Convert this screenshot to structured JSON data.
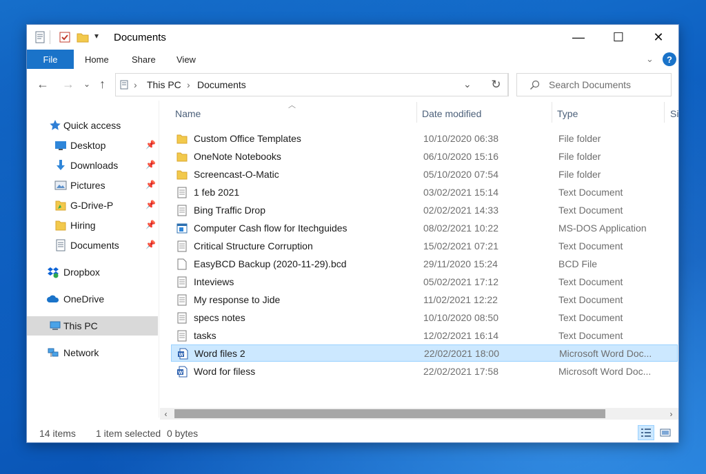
{
  "window": {
    "title": "Documents",
    "controls": {
      "minimize": "—",
      "maximize": "☐",
      "close": "✕"
    }
  },
  "ribbon": {
    "file": "File",
    "tabs": [
      "Home",
      "Share",
      "View"
    ],
    "help": "?"
  },
  "address": {
    "crumbs": [
      "This PC",
      "Documents"
    ],
    "search_placeholder": "Search Documents"
  },
  "navigation": {
    "items": [
      {
        "label": "Quick access",
        "icon": "star-icon",
        "pinned": false
      },
      {
        "label": "Desktop",
        "icon": "desktop-icon",
        "pinned": true
      },
      {
        "label": "Downloads",
        "icon": "download-arrow-icon",
        "pinned": true
      },
      {
        "label": "Pictures",
        "icon": "pictures-icon",
        "pinned": true
      },
      {
        "label": "G-Drive-P",
        "icon": "folder-icon",
        "pinned": true
      },
      {
        "label": "Hiring",
        "icon": "folder-icon",
        "pinned": true
      },
      {
        "label": "Documents",
        "icon": "documents-icon",
        "pinned": true
      },
      {
        "label": "Dropbox",
        "icon": "dropbox-icon",
        "pinned": false
      },
      {
        "label": "OneDrive",
        "icon": "cloud-icon",
        "pinned": false
      },
      {
        "label": "This PC",
        "icon": "computer-icon",
        "pinned": false,
        "selected": true
      },
      {
        "label": "Network",
        "icon": "network-icon",
        "pinned": false
      }
    ]
  },
  "columns": {
    "name": "Name",
    "date": "Date modified",
    "type": "Type",
    "size": "Si"
  },
  "files": [
    {
      "name": "Custom Office Templates",
      "date": "10/10/2020 06:38",
      "type": "File folder",
      "icon": "folder-icon"
    },
    {
      "name": "OneNote Notebooks",
      "date": "06/10/2020 15:16",
      "type": "File folder",
      "icon": "folder-icon"
    },
    {
      "name": "Screencast-O-Matic",
      "date": "05/10/2020 07:54",
      "type": "File folder",
      "icon": "folder-icon"
    },
    {
      "name": "1 feb 2021",
      "date": "03/02/2021 15:14",
      "type": "Text Document",
      "icon": "text-file-icon"
    },
    {
      "name": "Bing Traffic Drop",
      "date": "02/02/2021 14:33",
      "type": "Text Document",
      "icon": "text-file-icon"
    },
    {
      "name": "Computer Cash flow for Itechguides",
      "date": "08/02/2021 10:22",
      "type": "MS-DOS Application",
      "icon": "application-icon"
    },
    {
      "name": "Critical Structure Corruption",
      "date": "15/02/2021 07:21",
      "type": "Text Document",
      "icon": "text-file-icon"
    },
    {
      "name": "EasyBCD Backup (2020-11-29).bcd",
      "date": "29/11/2020 15:24",
      "type": "BCD File",
      "icon": "blank-file-icon"
    },
    {
      "name": "Inteviews",
      "date": "05/02/2021 17:12",
      "type": "Text Document",
      "icon": "text-file-icon"
    },
    {
      "name": "My response to Jide",
      "date": "11/02/2021 12:22",
      "type": "Text Document",
      "icon": "text-file-icon"
    },
    {
      "name": "specs notes",
      "date": "10/10/2020 08:50",
      "type": "Text Document",
      "icon": "text-file-icon"
    },
    {
      "name": "tasks",
      "date": "12/02/2021 16:14",
      "type": "Text Document",
      "icon": "text-file-icon"
    },
    {
      "name": "Word files 2",
      "date": "22/02/2021 18:00",
      "type": "Microsoft Word Doc...",
      "icon": "word-doc-icon",
      "selected": true
    },
    {
      "name": "Word for filess",
      "date": "22/02/2021 17:58",
      "type": "Microsoft Word Doc...",
      "icon": "word-doc-icon"
    }
  ],
  "status": {
    "count": "14 items",
    "selection": "1 item selected",
    "size": "0 bytes"
  },
  "colors": {
    "accent": "#1a73c9",
    "selection_bg": "#cce8ff",
    "folder": "#f2c94c"
  }
}
